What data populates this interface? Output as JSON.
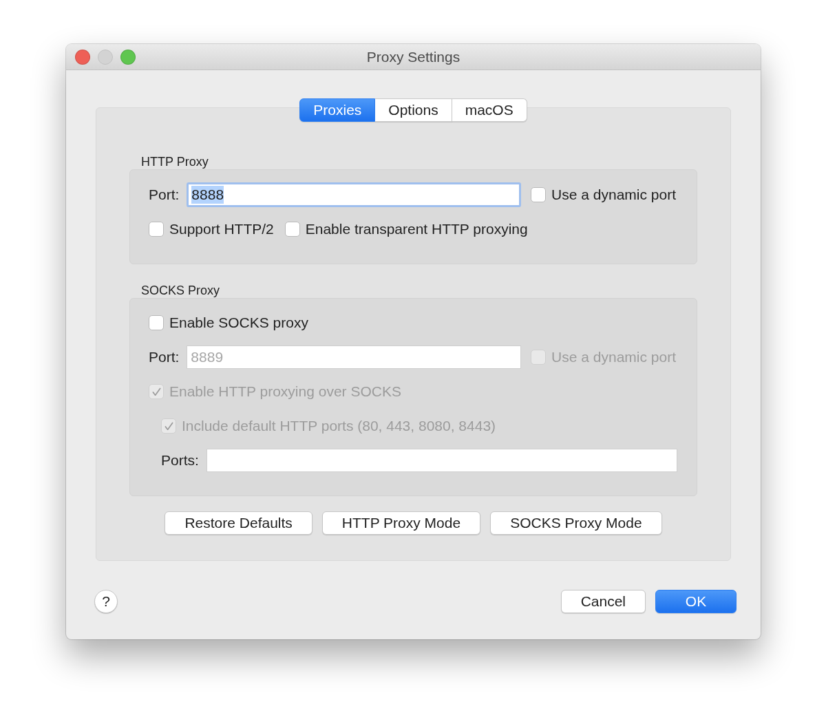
{
  "window": {
    "title": "Proxy Settings",
    "controls": [
      {
        "kind": "close",
        "disabled": false
      },
      {
        "kind": "minimize",
        "disabled": true
      },
      {
        "kind": "zoom",
        "disabled": false
      }
    ]
  },
  "tabs": [
    {
      "label": "Proxies",
      "selected": true
    },
    {
      "label": "Options",
      "selected": false
    },
    {
      "label": "macOS",
      "selected": false
    }
  ],
  "sections": [
    {
      "title": "HTTP Proxy",
      "rows": [
        {
          "controls": [
            {
              "kind": "field",
              "label": "Port:",
              "value": "8888",
              "focused": true,
              "value_selected": true,
              "disabled": false
            },
            {
              "kind": "checkbox",
              "label": "Use a dynamic port",
              "checked": false,
              "disabled": false
            }
          ]
        },
        {
          "controls": [
            {
              "kind": "checkbox",
              "label": "Support HTTP/2",
              "checked": false,
              "disabled": false
            },
            {
              "kind": "checkbox",
              "label": "Enable transparent HTTP proxying",
              "checked": false,
              "disabled": false
            }
          ]
        }
      ]
    },
    {
      "title": "SOCKS Proxy",
      "rows": [
        {
          "controls": [
            {
              "kind": "checkbox",
              "label": "Enable SOCKS proxy",
              "checked": false,
              "disabled": false
            }
          ]
        },
        {
          "controls": [
            {
              "kind": "field",
              "label": "Port:",
              "value": "8889",
              "focused": false,
              "value_selected": false,
              "disabled": true
            },
            {
              "kind": "checkbox",
              "label": "Use a dynamic port",
              "checked": false,
              "disabled": true
            }
          ]
        },
        {
          "controls": [
            {
              "kind": "checkbox",
              "label": "Enable HTTP proxying over SOCKS",
              "checked": true,
              "disabled": true
            }
          ],
          "children": [
            {
              "controls": [
                {
                  "kind": "checkbox",
                  "label": "Include default HTTP ports (80, 443, 8080, 8443)",
                  "checked": true,
                  "disabled": true
                }
              ]
            },
            {
              "controls": [
                {
                  "kind": "field",
                  "label": "Ports:",
                  "focused": false
                }
              ]
            }
          ]
        }
      ]
    }
  ],
  "panel_buttons": [
    {
      "label": "Restore Defaults"
    },
    {
      "label": "HTTP Proxy Mode"
    },
    {
      "label": "SOCKS Proxy Mode"
    }
  ],
  "footer": {
    "help_button": "?",
    "buttons": [
      {
        "label": "Cancel",
        "default": false
      },
      {
        "label": "OK",
        "default": true
      }
    ]
  }
}
